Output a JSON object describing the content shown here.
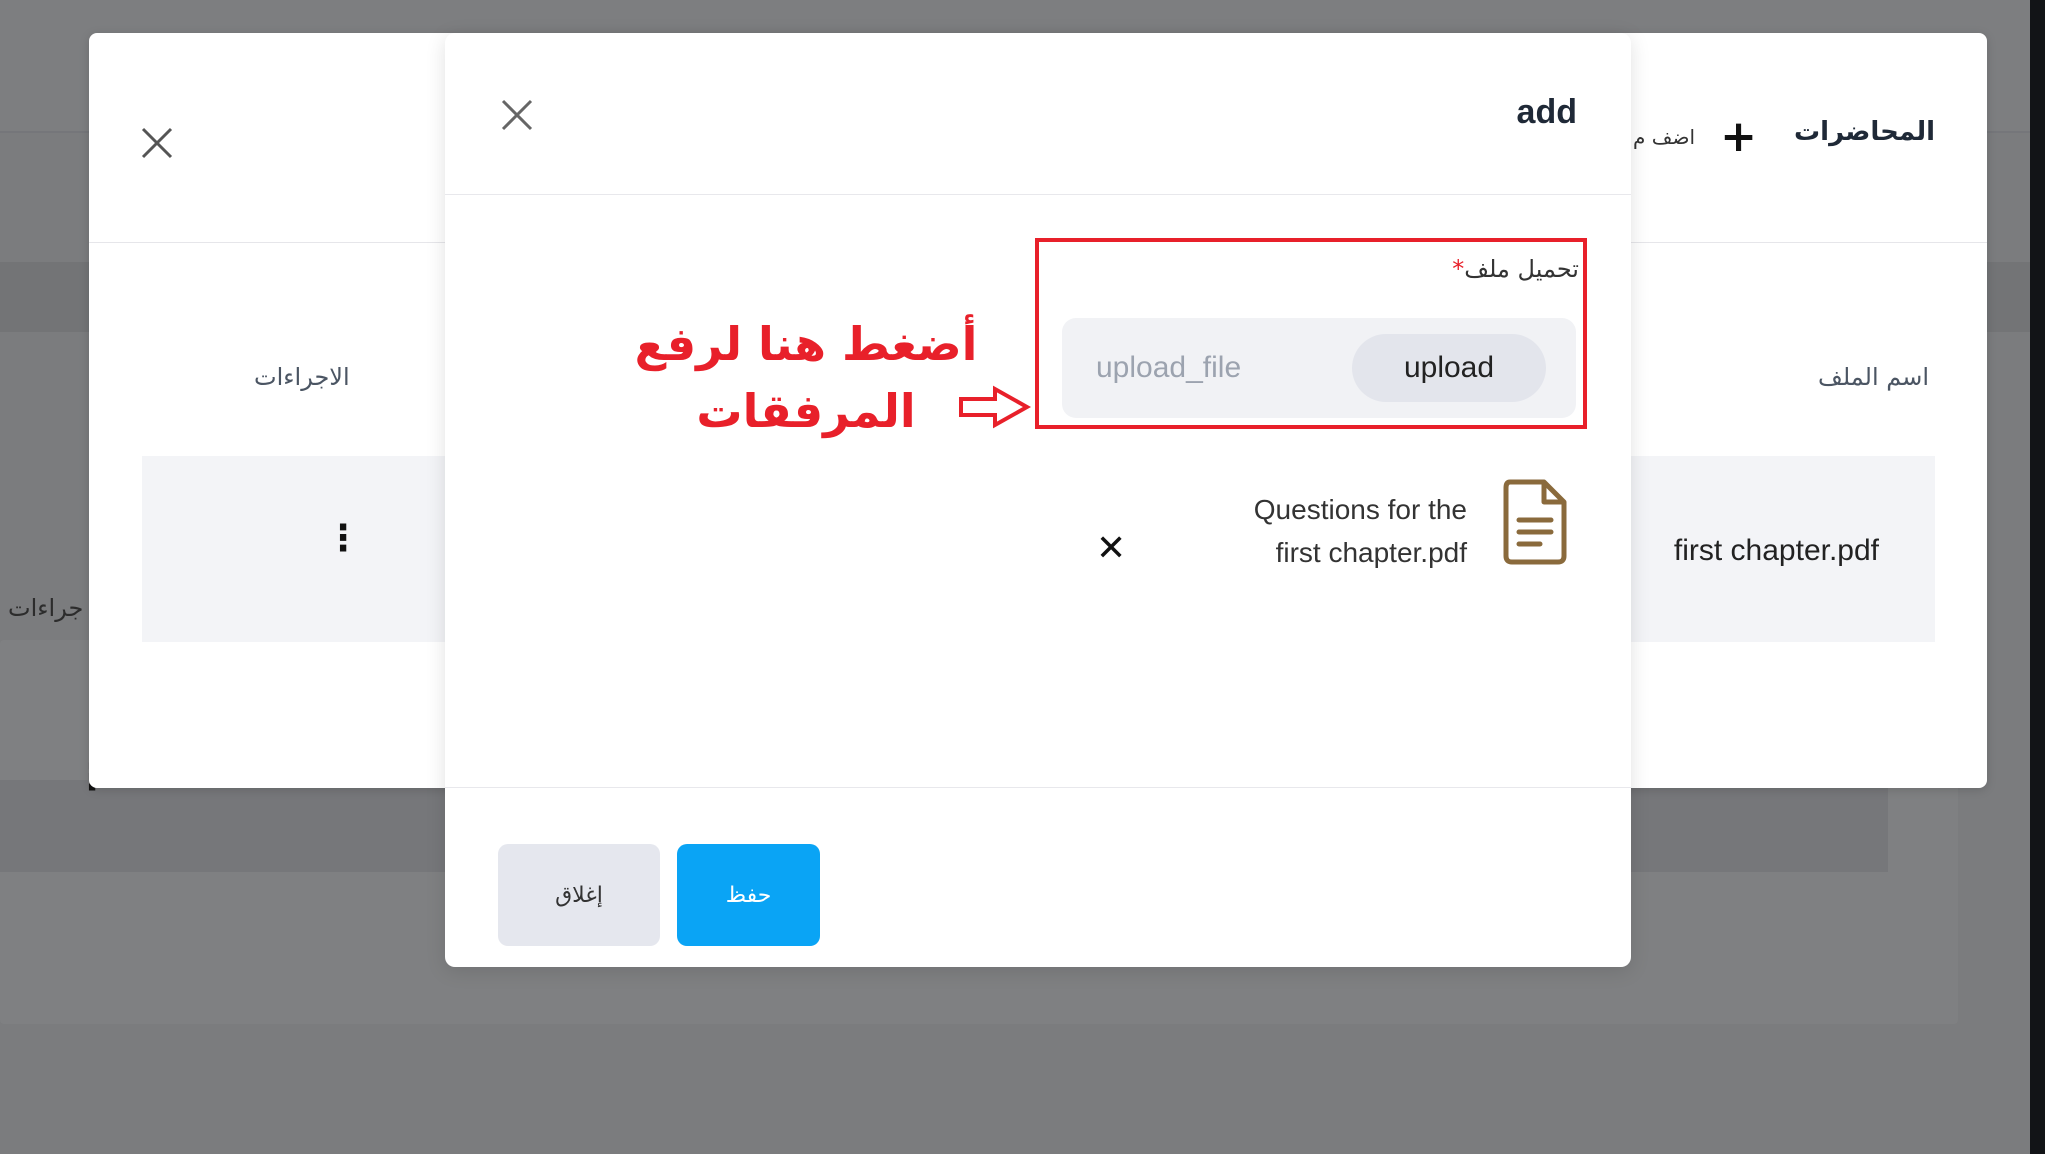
{
  "background": {
    "cut_actions_label": "جراءات",
    "row_menu_icon": "more-vertical-icon"
  },
  "lectures_dialog": {
    "title": "المحاضرات",
    "add_label": "اضف م",
    "close_icon": "close-icon",
    "plus_icon": "plus-icon",
    "columns": {
      "file_name": "اسم الملف",
      "actions": "الاجراءات"
    },
    "rows": [
      {
        "file_name": "first chapter.pdf",
        "menu_icon": "more-vertical-icon"
      }
    ]
  },
  "add_dialog": {
    "title": "add",
    "close_icon": "close-icon",
    "upload": {
      "label": "تحميل ملف",
      "required_mark": "*",
      "placeholder": "upload_file",
      "button_label": "upload"
    },
    "annotation": {
      "text": "أضغط هنا لرفع المرفقات",
      "color": "#e8202a"
    },
    "attachment": {
      "file_name": "Questions for the first chapter.pdf",
      "file_icon": "document-icon",
      "remove_icon": "x-icon"
    },
    "footer": {
      "save_label": "حفظ",
      "close_label": "إغلاق"
    }
  },
  "colors": {
    "accent": "#0aa4f5",
    "annotation_red": "#e8202a",
    "overlay": "#7b7c7e",
    "file_icon": "#8a6a3c"
  }
}
